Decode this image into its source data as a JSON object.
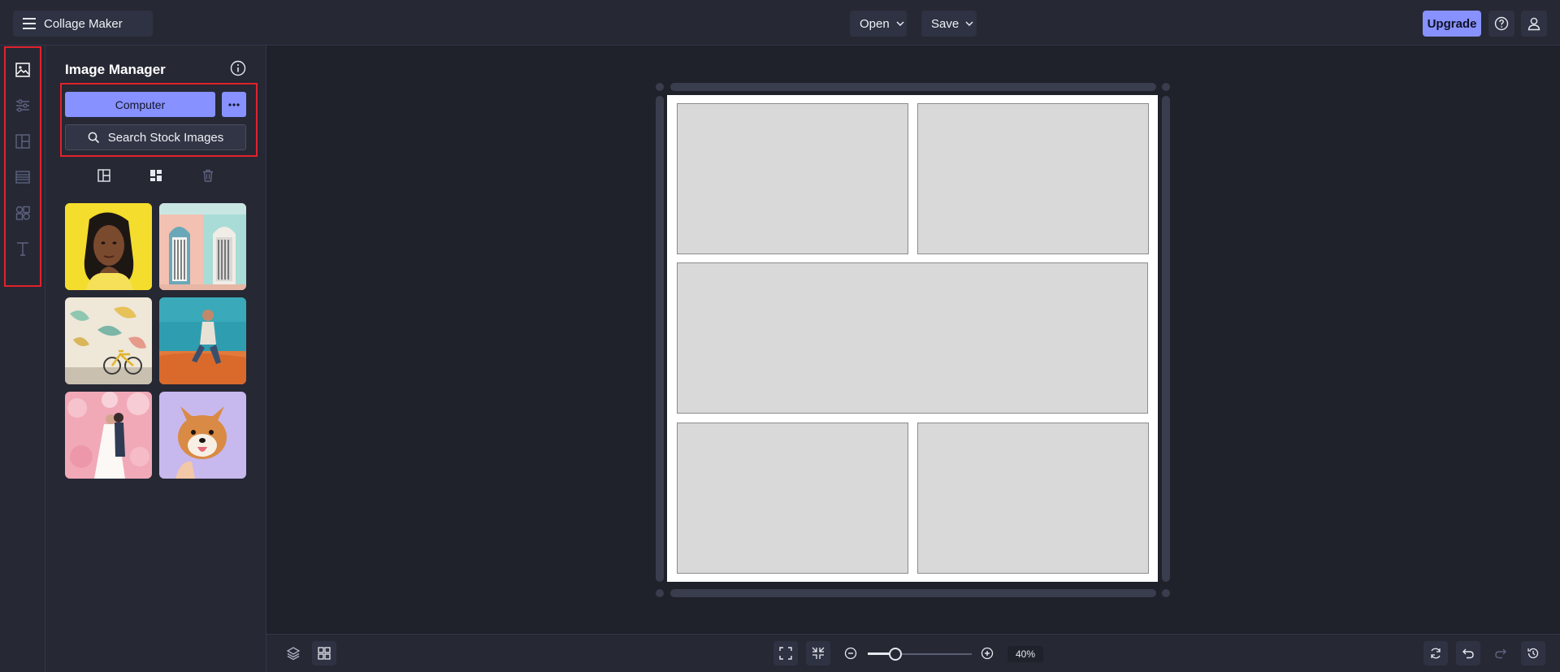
{
  "app": {
    "title": "Collage Maker",
    "menu_icon": "hamburger-icon"
  },
  "header": {
    "open_label": "Open",
    "save_label": "Save",
    "upgrade_label": "Upgrade",
    "help_icon": "help-icon",
    "account_icon": "user-icon"
  },
  "rail": {
    "items": [
      {
        "icon": "image-icon",
        "active": true
      },
      {
        "icon": "sliders-icon",
        "active": false
      },
      {
        "icon": "layout-icon",
        "active": false
      },
      {
        "icon": "texture-icon",
        "active": false
      },
      {
        "icon": "shapes-icon",
        "active": false
      },
      {
        "icon": "text-icon",
        "active": false
      }
    ]
  },
  "panel": {
    "title": "Image Manager",
    "computer_label": "Computer",
    "stock_label": "Search Stock Images",
    "thumbnails": [
      "portrait-woman-yellow",
      "pastel-doors",
      "bicycle-mural",
      "man-sitting-desert",
      "couple-pink-flowers",
      "shiba-dog-purple"
    ]
  },
  "canvas": {
    "cell_count": 5
  },
  "footer": {
    "zoom_value": "40%",
    "zoom_level": 0.25
  },
  "colors": {
    "accent": "#8791ff",
    "highlight": "#e0222d",
    "background": "#1f212b",
    "panel": "#262834"
  }
}
